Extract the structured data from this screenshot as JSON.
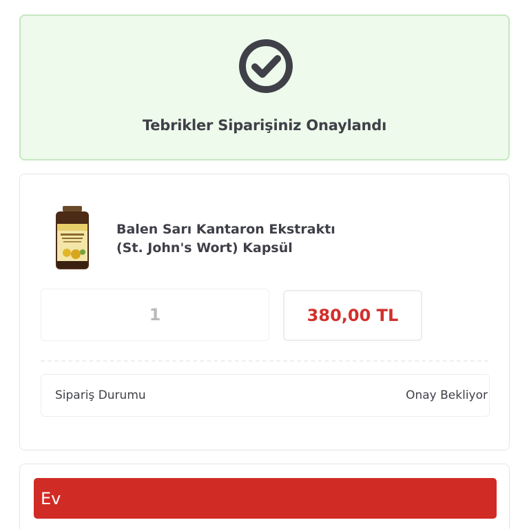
{
  "success": {
    "icon": "check-circle-icon",
    "title": "Tebrikler Siparişiniz Onaylandı"
  },
  "order": {
    "product": {
      "image_icon": "product-bottle-image",
      "name_line1": "Balen Sarı Kantaron Ekstraktı",
      "name_line2": "(St. John's Wort) Kapsül"
    },
    "quantity": "1",
    "price": "380,00 TL",
    "status_label": "Sipariş Durumu",
    "status_value": "Onay Bekliyor"
  },
  "address": {
    "tab_label": "Ev"
  },
  "colors": {
    "success_bg": "#eefaeb",
    "success_border": "#c5e7c0",
    "price": "#d22f2b",
    "accent_red": "#d12b26"
  }
}
